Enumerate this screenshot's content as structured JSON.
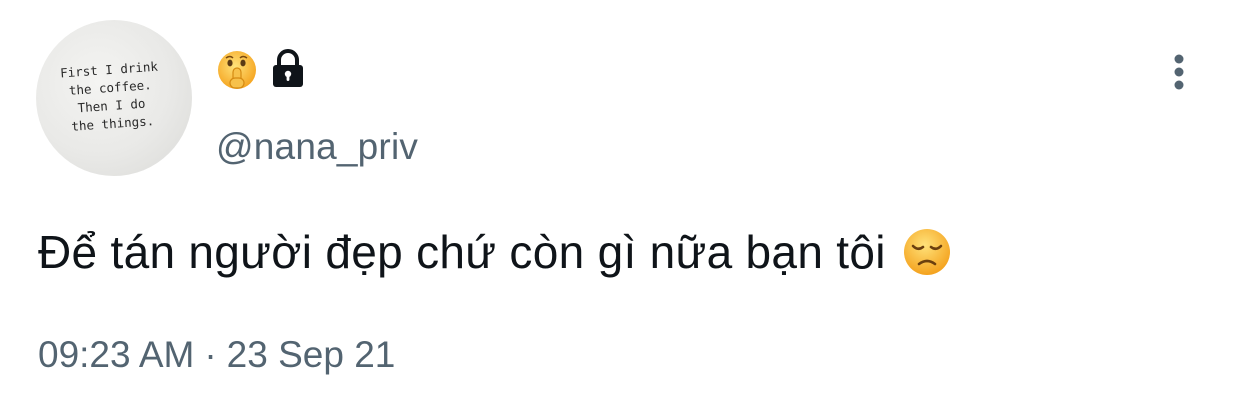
{
  "tweet": {
    "avatar_text": "First I drink\nthe coffee.\nThen I do\nthe things.",
    "display_name_icons": [
      "shushing-face-emoji",
      "lock-icon"
    ],
    "handle": "@nana_priv",
    "text": "Để tán người đẹp chứ còn gì nữa bạn tôi",
    "text_emoji": "disappointed-face-emoji",
    "time": "09:23 AM",
    "separator": "·",
    "date": "23 Sep 21",
    "more_icon": "more-vertical-icon"
  },
  "colors": {
    "text_primary": "#0f1419",
    "text_secondary": "#536471",
    "background": "#ffffff"
  }
}
